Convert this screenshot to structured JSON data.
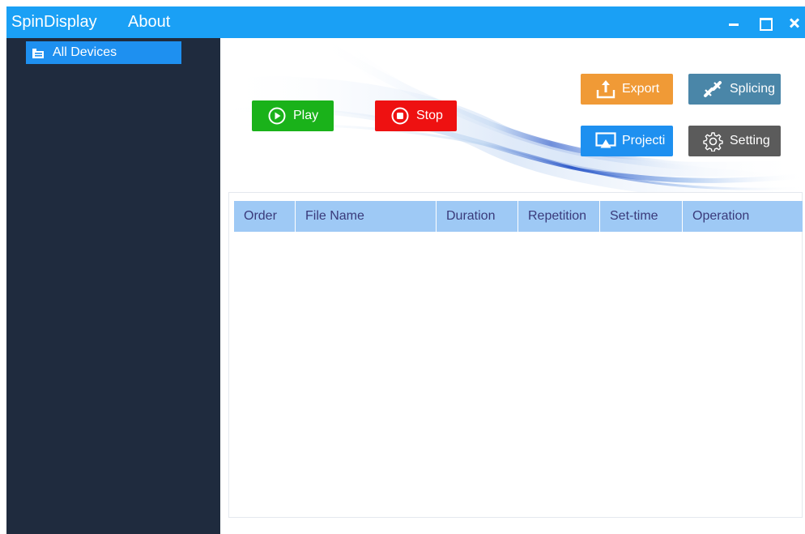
{
  "titlebar": {
    "app_name": "SpinDisplay",
    "about": "About",
    "controls": [
      "minimize-icon",
      "maximize-icon",
      "close-icon"
    ]
  },
  "sidebar": {
    "items": [
      {
        "label": "All Devices",
        "icon": "folder-icon",
        "selected": true
      }
    ]
  },
  "toolbar": {
    "play": "Play",
    "stop": "Stop",
    "export": "Export",
    "splicing": "Splicing",
    "projection": "Projecti",
    "setting": "Setting"
  },
  "table": {
    "columns": [
      "Order",
      "File Name",
      "Duration",
      "Repetition",
      "Set-time",
      "Operation"
    ],
    "rows": []
  },
  "colors": {
    "titlebar": "#1aa0f5",
    "sidebar": "#1f2b3e",
    "selected": "#1e90f0",
    "play": "#1ab21a",
    "stop": "#ee1111",
    "export": "#f09a36",
    "splicing": "#4a86a8",
    "projection": "#1e90f0",
    "setting": "#5b5b5b",
    "table_header": "#9ec9f5"
  }
}
